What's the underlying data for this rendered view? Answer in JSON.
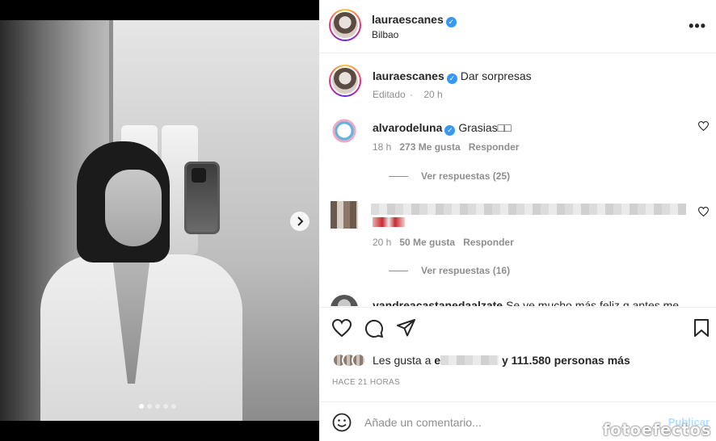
{
  "post": {
    "carousel": {
      "slide_count": 5,
      "active_slide": 1
    },
    "header": {
      "username": "lauraescanes",
      "verified": true,
      "location": "Bilbao",
      "more_icon": "more-horizontal-icon"
    },
    "caption": {
      "username": "lauraescanes",
      "text": "Dar sorpresas",
      "edited_label": "Editado",
      "time": "20 h"
    },
    "comments": [
      {
        "username": "alvarodeluna",
        "text": "Grasias□□",
        "time": "18 h",
        "likes": "273 Me gusta",
        "reply_label": "Responder",
        "view_replies": "Ver respuestas (25)"
      },
      {
        "username": "",
        "text": "",
        "time": "20 h",
        "likes": "50 Me gusta",
        "reply_label": "Responder",
        "view_replies": "Ver respuestas (16)"
      },
      {
        "username": "yandreacastanedaalzate",
        "text": "Se ve mucho más feliz q antes me"
      }
    ],
    "likes": {
      "prefix": "Les gusta a",
      "name_start": "e",
      "suffix": "y 111.580 personas más"
    },
    "timestamp": "HACE 21 HORAS",
    "add_comment": {
      "placeholder": "Añade un comentario...",
      "post_label": "Publicar"
    },
    "watermark": "fotoefectos"
  }
}
